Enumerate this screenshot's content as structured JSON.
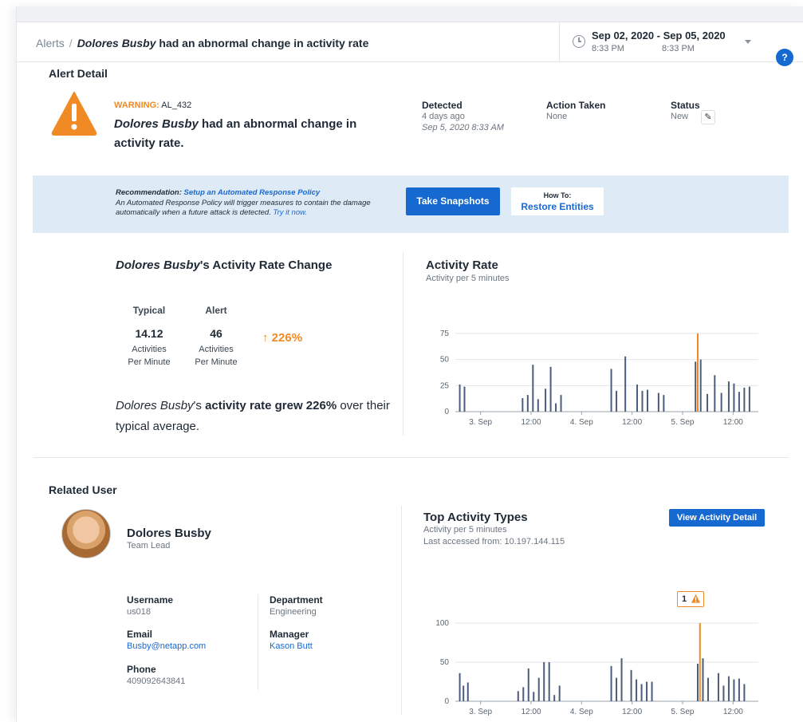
{
  "breadcrumb": {
    "root": "Alerts",
    "separator": "/",
    "user": "Dolores Busby",
    "rest": "had an abnormal change in activity rate"
  },
  "date_range": {
    "range": "Sep 02, 2020 - Sep 05, 2020",
    "start_time": "8:33 PM",
    "end_time": "8:33 PM",
    "icon": "clock-icon"
  },
  "help_icon": {
    "glyph": "?"
  },
  "alert_detail": {
    "title": "Alert Detail",
    "warning_label": "WARNING:",
    "alert_id": "AL_432",
    "headline_user": "Dolores Busby",
    "headline_rest": " had an abnormal change in activity rate.",
    "detected_label": "Detected",
    "detected_relative": "4 days ago",
    "detected_time": "Sep 5, 2020 8:33 AM",
    "action_label": "Action Taken",
    "action_value": "None",
    "status_label": "Status",
    "status_value": "New",
    "edit_glyph": "✎"
  },
  "recommendation": {
    "label": "Recommendation:",
    "link": "Setup an Automated Response Policy",
    "body": "An Automated Response Policy will trigger measures to contain the damage automatically when a future attack is detected.",
    "try_link": "Try it now.",
    "snapshot_button": "Take Snapshots",
    "howto_top": "How To:",
    "howto_bottom": "Restore Entities"
  },
  "rate_change": {
    "title_user": "Dolores Busby",
    "title_rest": "'s Activity Rate Change",
    "typical_label": "Typical",
    "typical_value": "14.12",
    "alert_label": "Alert",
    "alert_value": "46",
    "unit_line1": "Activities",
    "unit_line2": "Per Minute",
    "change_pct": "↑ 226%",
    "summary_user": "Dolores Busby",
    "summary_mid": "'s ",
    "summary_bold": "activity rate grew 226%",
    "summary_end": " over their typical average."
  },
  "activity_rate": {
    "title": "Activity Rate",
    "subtitle": "Activity per 5 minutes"
  },
  "related_user": {
    "title": "Related User",
    "name": "Dolores Busby",
    "role": "Team Lead",
    "username_label": "Username",
    "username": "us018",
    "department_label": "Department",
    "department": "Engineering",
    "email_label": "Email",
    "email": "Busby@netapp.com",
    "manager_label": "Manager",
    "manager": "Kason Butt",
    "phone_label": "Phone",
    "phone": "409092643841"
  },
  "top_activity": {
    "title": "Top Activity Types",
    "subtitle": "Activity per 5 minutes",
    "last_access": "Last accessed from: 10.197.144.115",
    "button": "View Activity Detail",
    "flag_count": "1"
  },
  "colors": {
    "accent": "#1769d2",
    "warning": "#f08a24",
    "bar": "#4b5d7a",
    "banner": "#dfeaf7"
  },
  "chart_data": [
    {
      "type": "bar",
      "title": "Activity Rate",
      "subtitle": "Activity per 5 minutes",
      "x_ticks": [
        "3. Sep",
        "12:00",
        "4. Sep",
        "12:00",
        "5. Sep",
        "12:00"
      ],
      "y_ticks": [
        0,
        25,
        50,
        75
      ],
      "ylim": [
        0,
        75
      ],
      "grid": true,
      "bars": [
        {
          "x": 0.3,
          "y": 26
        },
        {
          "x": 0.62,
          "y": 24
        },
        {
          "x": 4.55,
          "y": 13
        },
        {
          "x": 4.9,
          "y": 16
        },
        {
          "x": 5.25,
          "y": 45
        },
        {
          "x": 5.6,
          "y": 12
        },
        {
          "x": 6.1,
          "y": 22
        },
        {
          "x": 6.45,
          "y": 43
        },
        {
          "x": 6.8,
          "y": 8
        },
        {
          "x": 7.15,
          "y": 16
        },
        {
          "x": 10.55,
          "y": 41
        },
        {
          "x": 10.9,
          "y": 20
        },
        {
          "x": 11.5,
          "y": 53
        },
        {
          "x": 12.3,
          "y": 26
        },
        {
          "x": 12.65,
          "y": 20
        },
        {
          "x": 13.0,
          "y": 21
        },
        {
          "x": 13.75,
          "y": 18
        },
        {
          "x": 14.1,
          "y": 16
        },
        {
          "x": 16.25,
          "y": 48
        },
        {
          "x": 16.6,
          "y": 50
        },
        {
          "x": 17.05,
          "y": 17
        },
        {
          "x": 17.55,
          "y": 35
        },
        {
          "x": 18.0,
          "y": 18
        },
        {
          "x": 18.5,
          "y": 29
        },
        {
          "x": 18.85,
          "y": 27
        },
        {
          "x": 19.2,
          "y": 19
        },
        {
          "x": 19.55,
          "y": 23
        },
        {
          "x": 19.9,
          "y": 24
        }
      ],
      "alert_bar": {
        "x": 16.4,
        "y": 75
      },
      "x_range": [
        0,
        20.5
      ]
    },
    {
      "type": "bar",
      "title": "Top Activity Types",
      "subtitle": "Activity per 5 minutes",
      "x_ticks": [
        "3. Sep",
        "12:00",
        "4. Sep",
        "12:00",
        "5. Sep",
        "12:00"
      ],
      "y_ticks": [
        0,
        50,
        100
      ],
      "ylim": [
        0,
        100
      ],
      "grid": true,
      "bars": [
        {
          "x": 0.3,
          "y": 36
        },
        {
          "x": 0.55,
          "y": 20
        },
        {
          "x": 0.85,
          "y": 24
        },
        {
          "x": 4.25,
          "y": 13
        },
        {
          "x": 4.6,
          "y": 18
        },
        {
          "x": 4.95,
          "y": 42
        },
        {
          "x": 5.3,
          "y": 12
        },
        {
          "x": 5.65,
          "y": 30
        },
        {
          "x": 6.0,
          "y": 50
        },
        {
          "x": 6.35,
          "y": 50
        },
        {
          "x": 6.7,
          "y": 8
        },
        {
          "x": 7.05,
          "y": 20
        },
        {
          "x": 10.55,
          "y": 45
        },
        {
          "x": 10.9,
          "y": 30
        },
        {
          "x": 11.25,
          "y": 55
        },
        {
          "x": 11.9,
          "y": 40
        },
        {
          "x": 12.25,
          "y": 28
        },
        {
          "x": 12.6,
          "y": 22
        },
        {
          "x": 12.95,
          "y": 25
        },
        {
          "x": 13.3,
          "y": 25
        },
        {
          "x": 16.4,
          "y": 48
        },
        {
          "x": 16.75,
          "y": 55
        },
        {
          "x": 17.1,
          "y": 30
        },
        {
          "x": 17.8,
          "y": 36
        },
        {
          "x": 18.15,
          "y": 20
        },
        {
          "x": 18.5,
          "y": 32
        },
        {
          "x": 18.85,
          "y": 28
        },
        {
          "x": 19.2,
          "y": 29
        },
        {
          "x": 19.55,
          "y": 22
        }
      ],
      "alert_bar": {
        "x": 16.55,
        "y": 100
      },
      "x_range": [
        0,
        20.5
      ]
    }
  ]
}
